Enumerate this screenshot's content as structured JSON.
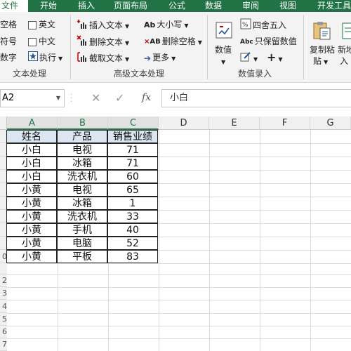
{
  "tabs": [
    "文件",
    "开始",
    "插入",
    "页面布局",
    "公式",
    "数据",
    "审阅",
    "视图",
    "开发工具"
  ],
  "ribbon": {
    "group1": {
      "items": [
        "空格",
        "英文",
        "符号",
        "中文",
        "数字",
        "执行"
      ],
      "label": "文本处理"
    },
    "group2": {
      "items": [
        "插入文本",
        "大小写",
        "删除文本",
        "删除空格",
        "截取文本",
        "更多"
      ],
      "label": "高级文本处理"
    },
    "group3": {
      "big": "数值",
      "items": [
        "四舍五入",
        "只保留数值"
      ],
      "label": "数值录入"
    },
    "group4": {
      "copy_paste_1": "复制粘",
      "copy_paste_2": "贴",
      "new1": "新地",
      "new2": "入"
    }
  },
  "formula": {
    "namebox": "A2",
    "value": "小白"
  },
  "columns": [
    "A",
    "B",
    "C",
    "D",
    "E",
    "F",
    "G"
  ],
  "rows": [
    "",
    "",
    "",
    "",
    "",
    "",
    "",
    "",
    "",
    "0",
    "",
    "2",
    "3",
    "4",
    "5",
    "6",
    "7"
  ],
  "table": {
    "headers": [
      "姓名",
      "产品",
      "销售业绩"
    ],
    "rows": [
      [
        "小白",
        "电视",
        "71"
      ],
      [
        "小白",
        "冰箱",
        "71"
      ],
      [
        "小白",
        "洗衣机",
        "60"
      ],
      [
        "小黄",
        "电视",
        "65"
      ],
      [
        "小黄",
        "冰箱",
        "1"
      ],
      [
        "小黄",
        "洗衣机",
        "33"
      ],
      [
        "小黄",
        "手机",
        "40"
      ],
      [
        "小黄",
        "电脑",
        "52"
      ],
      [
        "小黄",
        "平板",
        "83"
      ]
    ]
  },
  "colors": {
    "accent": "#217346",
    "header_fill": "#dce6f1"
  }
}
